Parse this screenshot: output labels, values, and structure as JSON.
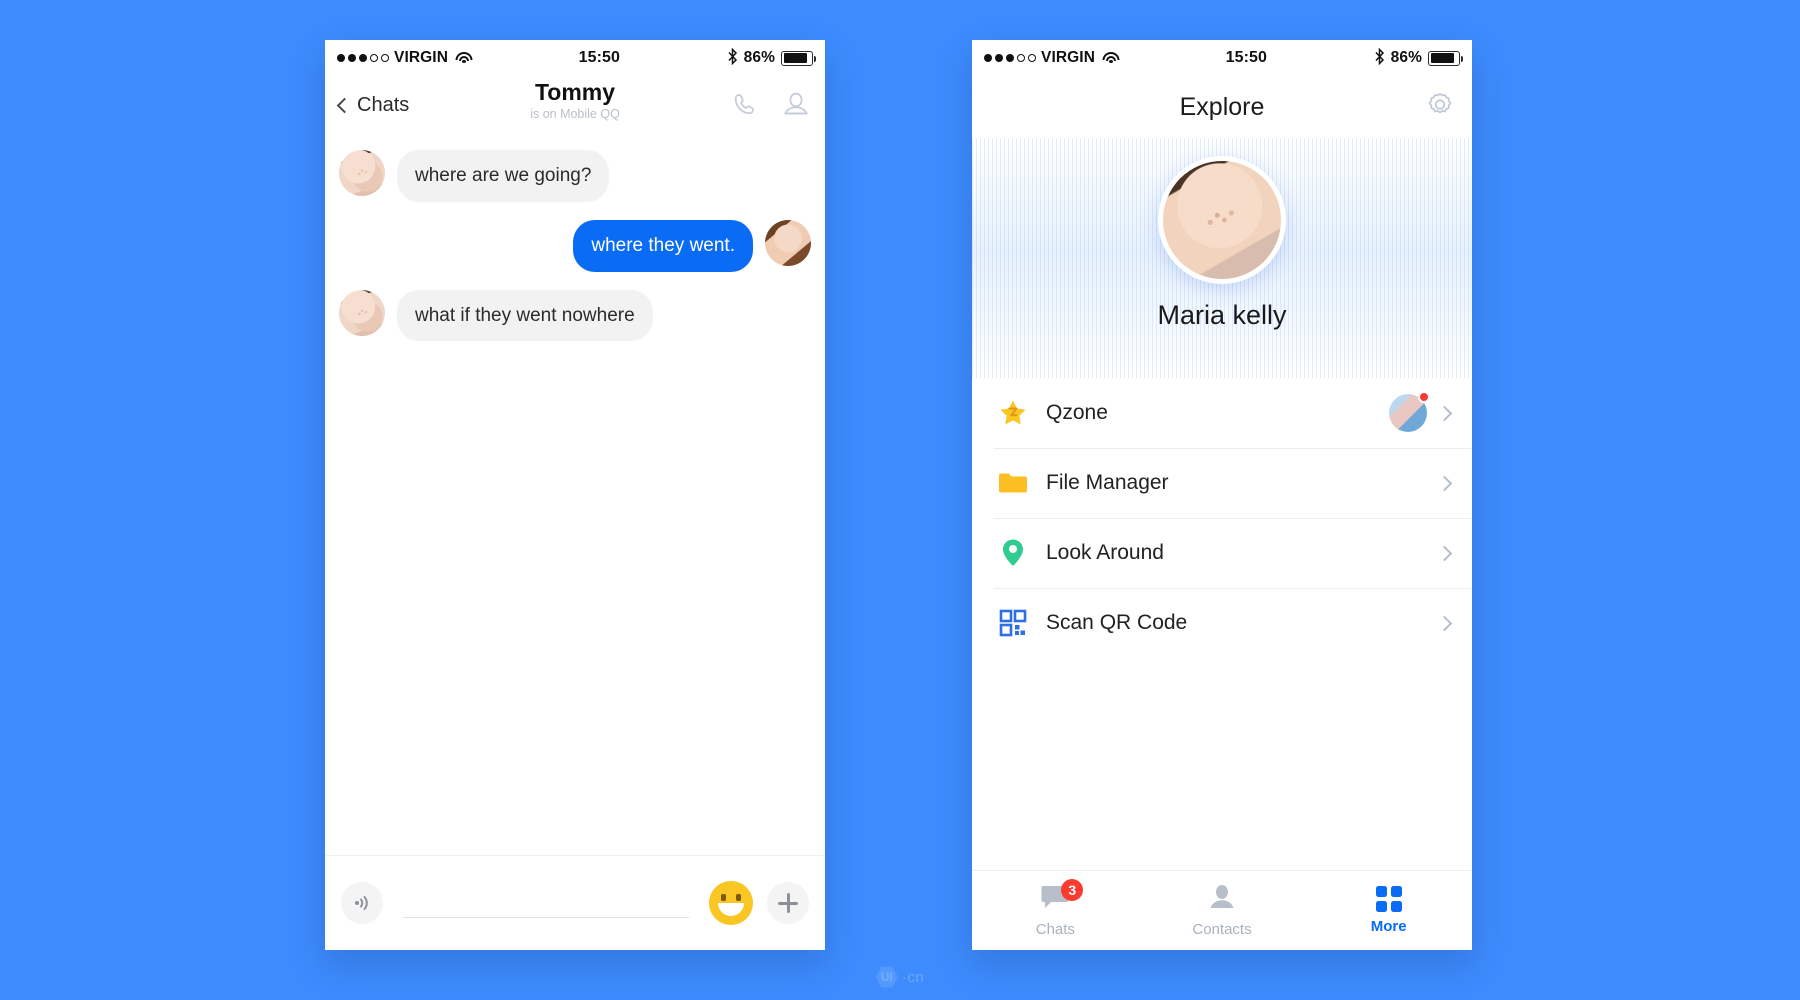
{
  "background_color": "#3d8bfd",
  "accent_blue": "#0a6cf5",
  "status_bar": {
    "carrier": "VIRGIN",
    "signal_dots_filled": 3,
    "signal_dots_total": 5,
    "wifi_icon": "wifi-icon",
    "time": "15:50",
    "bluetooth_icon": "bluetooth-icon",
    "battery_percent": "86%",
    "battery_level": 86
  },
  "chat_screen": {
    "nav": {
      "back_label": "Chats",
      "back_icon": "chevron-left-icon",
      "title": "Tommy",
      "subtitle": "is on Mobile QQ",
      "call_icon": "phone-call-icon",
      "profile_icon": "person-outline-icon"
    },
    "messages": [
      {
        "id": 1,
        "direction": "in",
        "text": "where are we going?",
        "avatar": "avatar-tommy"
      },
      {
        "id": 2,
        "direction": "out",
        "text": "where they went.",
        "avatar": "avatar-maria"
      },
      {
        "id": 3,
        "direction": "in",
        "text": "what if they went nowhere",
        "avatar": "avatar-tommy"
      }
    ],
    "input_bar": {
      "voice_icon": "voice-wave-icon",
      "text_placeholder": "",
      "text_value": "",
      "emoji_icon": "smiley-face-icon",
      "plus_icon": "plus-icon"
    }
  },
  "explore_screen": {
    "nav": {
      "title": "Explore",
      "settings_icon": "gear-icon"
    },
    "profile": {
      "name": "Maria kelly",
      "avatar": "avatar-maria-large"
    },
    "menu_items": [
      {
        "label": "Qzone",
        "icon": "star-qzone-icon",
        "icon_color": "#f7c224",
        "has_thumbnail": true,
        "has_red_dot": true,
        "chevron": "chevron-right-icon"
      },
      {
        "label": "File Manager",
        "icon": "folder-icon",
        "icon_color": "#fbbf24",
        "has_thumbnail": false,
        "has_red_dot": false,
        "chevron": "chevron-right-icon"
      },
      {
        "label": "Look Around",
        "icon": "location-pin-icon",
        "icon_color": "#2ecc8f",
        "has_thumbnail": false,
        "has_red_dot": false,
        "chevron": "chevron-right-icon"
      },
      {
        "label": "Scan QR Code",
        "icon": "qr-code-icon",
        "icon_color": "#2f6fe4",
        "has_thumbnail": false,
        "has_red_dot": false,
        "chevron": "chevron-right-icon"
      }
    ],
    "tabs": [
      {
        "label": "Chats",
        "icon": "chat-bubble-icon",
        "badge": "3",
        "active": false
      },
      {
        "label": "Contacts",
        "icon": "person-icon",
        "badge": null,
        "active": false
      },
      {
        "label": "More",
        "icon": "grid-squares-icon",
        "badge": null,
        "active": true
      }
    ]
  },
  "watermark": {
    "mark": "UI",
    "text": "·cn"
  }
}
